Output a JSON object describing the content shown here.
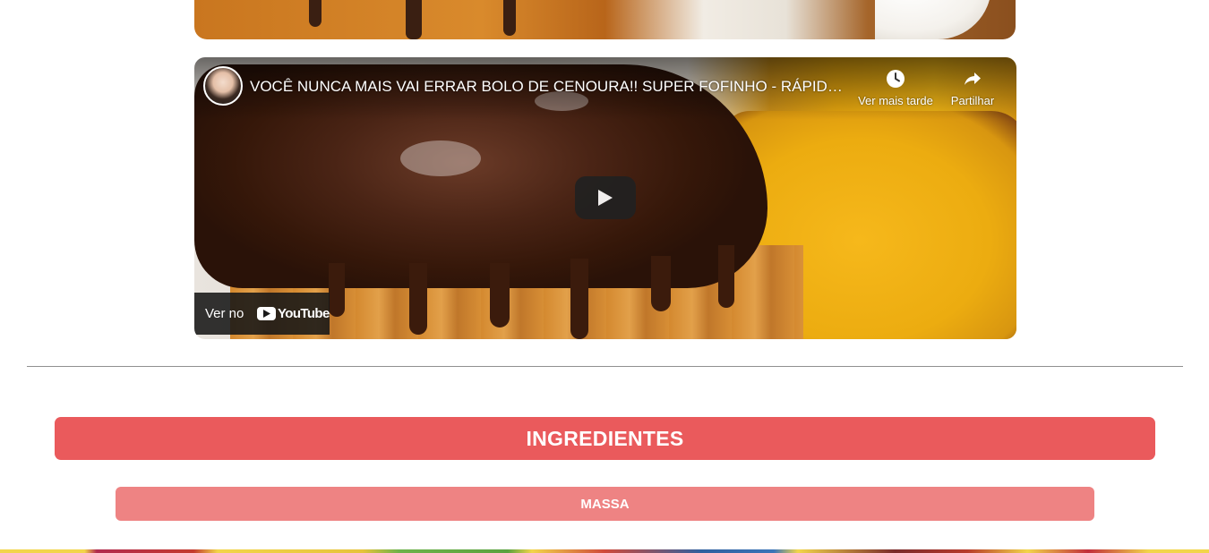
{
  "video": {
    "title": "VOCÊ NUNCA MAIS VAI ERRAR BOLO DE CENOURA!! SUPER FOFINHO - RÁPIDO E SEM LIQUIDIFICADOR",
    "watch_later_label": "Ver mais tarde",
    "share_label": "Partilhar",
    "watch_on_label": "Ver no",
    "youtube_wordmark": "YouTube"
  },
  "recipe": {
    "ingredients_heading": "INGREDIENTES",
    "sections": [
      {
        "label": "MASSA"
      }
    ]
  },
  "colors": {
    "heading_bg": "#ea5a5c",
    "subheading_bg": "#ee8383",
    "divider": "#8f8f8f"
  },
  "icons": [
    "clock-icon",
    "share-icon",
    "play-icon",
    "youtube-logo-icon"
  ]
}
